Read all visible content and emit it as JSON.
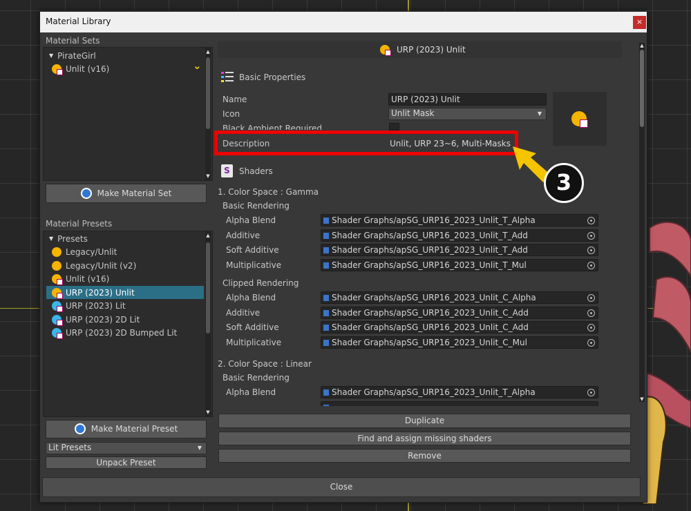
{
  "window": {
    "title": "Material Library",
    "close_glyph": "×"
  },
  "left": {
    "sets_label": "Material Sets",
    "sets_root": "PirateGirl",
    "sets_items": [
      {
        "label": "Unlit (v16)",
        "icon": "unlit-material-icon"
      }
    ],
    "check_glyph": "⌄",
    "make_set_label": "Make Material Set",
    "presets_label": "Material Presets",
    "presets_root": "Presets",
    "presets_items": [
      {
        "label": "Legacy/Unlit"
      },
      {
        "label": "Legacy/Unlit (v2)"
      },
      {
        "label": "Unlit (v16)"
      },
      {
        "label": "URP (2023) Unlit"
      },
      {
        "label": "URP (2023) Lit"
      },
      {
        "label": "URP (2023) 2D Lit"
      },
      {
        "label": "URP (2023) 2D Bumped Lit"
      }
    ],
    "selected_preset": "URP (2023) Unlit",
    "make_preset_label": "Make Material Preset",
    "lit_presets_value": "Lit Presets",
    "unpack_label": "Unpack Preset"
  },
  "right": {
    "header_title": "URP (2023) Unlit",
    "basic_props_title": "Basic Properties",
    "name_label": "Name",
    "name_value": "URP (2023) Unlit",
    "icon_label": "Icon",
    "icon_value": "Unlit Mask",
    "black_ambient_label": "Black Ambient Required",
    "description_label": "Description",
    "description_value": "Unlit, URP 23~6, Multi-Masks",
    "shaders_title": "Shaders",
    "groups": [
      {
        "title": "1. Color Space : Gamma",
        "sections": [
          {
            "title": "Basic Rendering",
            "rows": [
              {
                "label": "Alpha Blend",
                "value": "Shader Graphs/apSG_URP16_2023_Unlit_T_Alpha"
              },
              {
                "label": "Additive",
                "value": "Shader Graphs/apSG_URP16_2023_Unlit_T_Add"
              },
              {
                "label": "Soft Additive",
                "value": "Shader Graphs/apSG_URP16_2023_Unlit_T_Add"
              },
              {
                "label": "Multiplicative",
                "value": "Shader Graphs/apSG_URP16_2023_Unlit_T_Mul"
              }
            ]
          },
          {
            "title": "Clipped Rendering",
            "rows": [
              {
                "label": "Alpha Blend",
                "value": "Shader Graphs/apSG_URP16_2023_Unlit_C_Alpha"
              },
              {
                "label": "Additive",
                "value": "Shader Graphs/apSG_URP16_2023_Unlit_C_Add"
              },
              {
                "label": "Soft Additive",
                "value": "Shader Graphs/apSG_URP16_2023_Unlit_C_Add"
              },
              {
                "label": "Multiplicative",
                "value": "Shader Graphs/apSG_URP16_2023_Unlit_C_Mul"
              }
            ]
          }
        ]
      },
      {
        "title": "2. Color Space : Linear",
        "sections": [
          {
            "title": "Basic Rendering",
            "rows": [
              {
                "label": "Alpha Blend",
                "value": "Shader Graphs/apSG_URP16_2023_Unlit_T_Alpha"
              }
            ]
          }
        ]
      }
    ],
    "buttons": {
      "duplicate": "Duplicate",
      "find_assign": "Find and assign missing shaders",
      "remove": "Remove"
    }
  },
  "footer": {
    "close_label": "Close"
  },
  "annotation": {
    "step_number": "3"
  },
  "colors": {
    "selection": "#2b6f87",
    "highlight_box": "#ee0000",
    "arrow": "#f5c400",
    "unlit_icon": "#f5b400",
    "lit_icon": "#3bb6e8"
  }
}
